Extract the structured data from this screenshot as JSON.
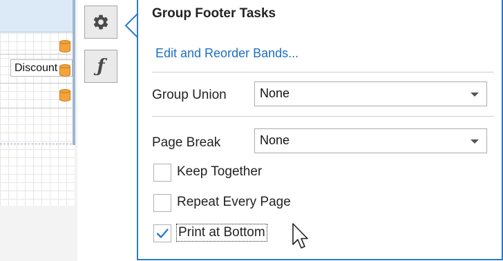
{
  "designer": {
    "discount_cell_text": "Discount"
  },
  "side_buttons": {
    "tasks_icon": "gear-icon",
    "expression_icon": "function-icon",
    "expression_glyph": "ƒ"
  },
  "panel": {
    "title": "Group Footer Tasks",
    "edit_bands_link": "Edit and Reorder Bands...",
    "group_union": {
      "label": "Group Union",
      "value": "None"
    },
    "page_break": {
      "label": "Page Break",
      "value": "None"
    },
    "checkboxes": {
      "keep_together": {
        "label": "Keep Together",
        "checked": false
      },
      "repeat_every_page": {
        "label": "Repeat Every Page",
        "checked": false
      },
      "print_at_bottom": {
        "label": "Print at Bottom",
        "checked": true
      }
    }
  },
  "colors": {
    "accent": "#2b79c8",
    "link": "#1b6fc2",
    "band_header": "#dce9f7",
    "field_icon": "#f5a33c"
  }
}
